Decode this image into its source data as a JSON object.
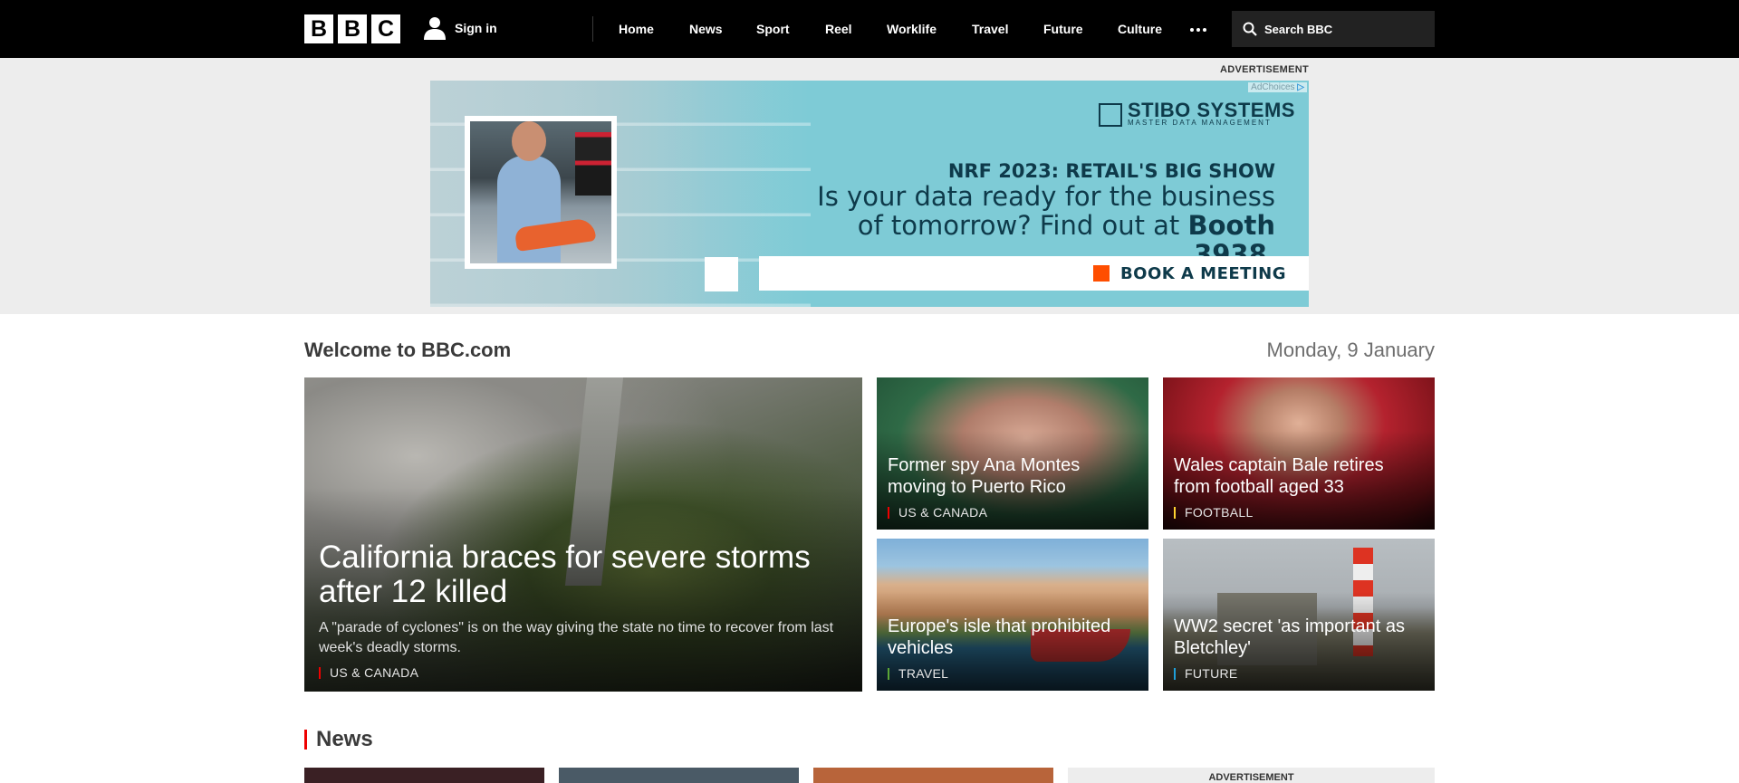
{
  "header": {
    "logo_letters": [
      "B",
      "B",
      "C"
    ],
    "signin_label": "Sign in",
    "nav": [
      "Home",
      "News",
      "Sport",
      "Reel",
      "Worklife",
      "Travel",
      "Future",
      "Culture"
    ],
    "more_icon": "more-dots-icon",
    "search_placeholder": "Search BBC"
  },
  "top_ad": {
    "label": "ADVERTISEMENT",
    "adchoices": "AdChoices",
    "brand_name": "STIBO SYSTEMS",
    "brand_tagline": "MASTER DATA MANAGEMENT",
    "kicker": "NRF 2023: RETAIL'S BIG SHOW",
    "headline_line1": "Is your data ready for the business",
    "headline_line2_prefix": "of tomorrow? Find out at ",
    "headline_booth": "Booth 3938",
    "headline_end": ".",
    "cta": "BOOK A MEETING",
    "accent": "#ff4e00"
  },
  "welcome": {
    "title": "Welcome to BBC.com",
    "date": "Monday, 9 January"
  },
  "stories": {
    "main": {
      "headline": "California braces for severe storms after 12 killed",
      "summary": "A \"parade of cyclones\" is on the way giving the state no time to recover from last week's deadly storms.",
      "tag": "US & CANADA",
      "tag_color": "#e00"
    },
    "spy": {
      "headline": "Former spy Ana Montes moving to Puerto Rico",
      "tag": "US & CANADA",
      "tag_color": "#e00"
    },
    "bale": {
      "headline": "Wales captain Bale retires from football aged 33",
      "tag": "FOOTBALL",
      "tag_color": "#ffd230"
    },
    "isle": {
      "headline": "Europe's isle that prohibited vehicles",
      "tag": "TRAVEL",
      "tag_color": "#5ca636"
    },
    "ww2": {
      "headline": "WW2 secret 'as important as Bletchley'",
      "tag": "FUTURE",
      "tag_color": "#1f9fd9"
    }
  },
  "news_section": {
    "title": "News",
    "accent": "#e00",
    "side_ad_label": "ADVERTISEMENT"
  }
}
